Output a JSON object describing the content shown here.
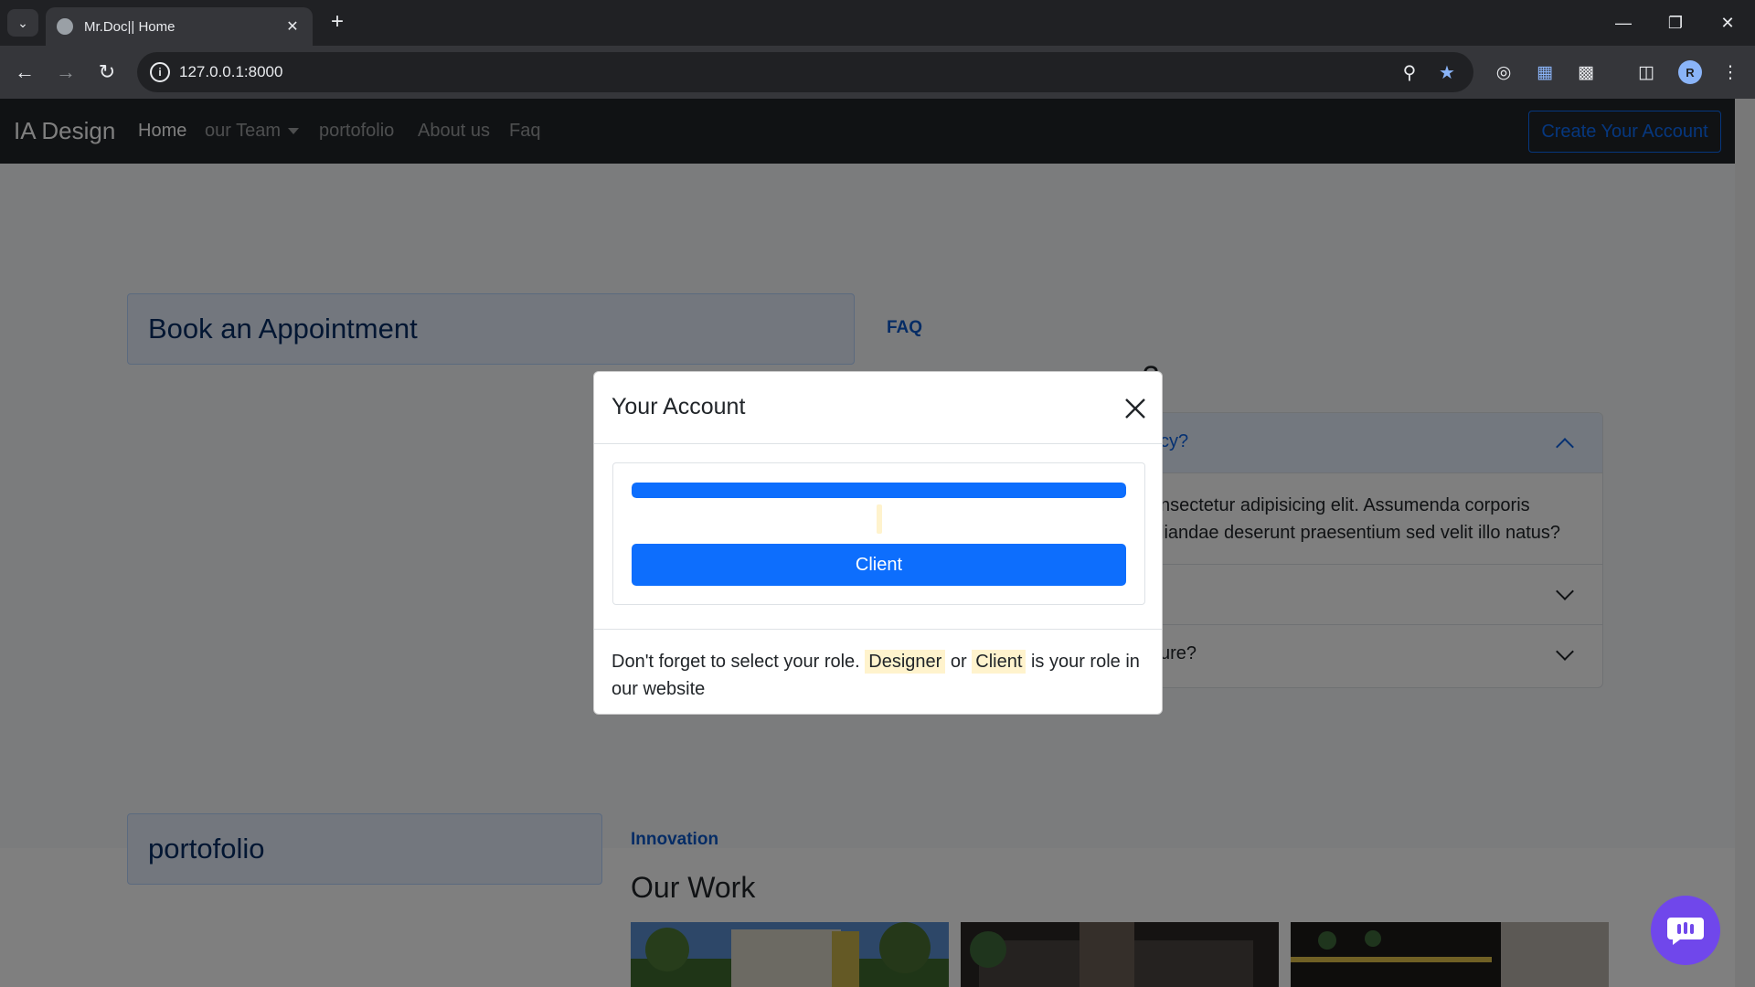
{
  "browser": {
    "tab_title": "Mr.Doc|| Home",
    "url": "127.0.0.1:8000",
    "profile_initial": "R"
  },
  "site": {
    "brand": "IA Design",
    "nav": [
      {
        "label": "Home",
        "active": true
      },
      {
        "label": "our Team",
        "dropdown": true
      },
      {
        "label": "portofolio"
      },
      {
        "label": "About us"
      },
      {
        "label": "Faq"
      }
    ],
    "create_account": "Create Your Account"
  },
  "appointment": {
    "title": "Book an Appointment"
  },
  "faq": {
    "kicker": "FAQ",
    "heading_visible": "?",
    "items": [
      {
        "question_visible": "cy?",
        "open": true,
        "answer_lines": [
          "nsectetur adipisicing elit. Assumenda corporis",
          "liandae deserunt praesentium sed velit illo natus?"
        ]
      },
      {
        "question_visible": "",
        "open": false
      },
      {
        "question_visible": "ure?",
        "open": false
      }
    ]
  },
  "portfolio": {
    "title": "portofolio",
    "kicker": "Innovation",
    "heading": "Our Work"
  },
  "modal": {
    "title": "Your Account",
    "progress_fraction": 1.0,
    "client_button": "Client",
    "footer": {
      "before": "Don't forget to select your role.",
      "role_designer": "Designer",
      "middle": "or",
      "role_client": "Client",
      "after": "is your role in our website"
    }
  },
  "icons": {
    "tab_search": "chevron-down-icon",
    "zoom": "zoom-icon",
    "bookmark": "star-icon",
    "chat": "chat-icon"
  },
  "colors": {
    "primary": "#0d6efd",
    "navbar": "#212529",
    "chat": "#7047eb"
  }
}
